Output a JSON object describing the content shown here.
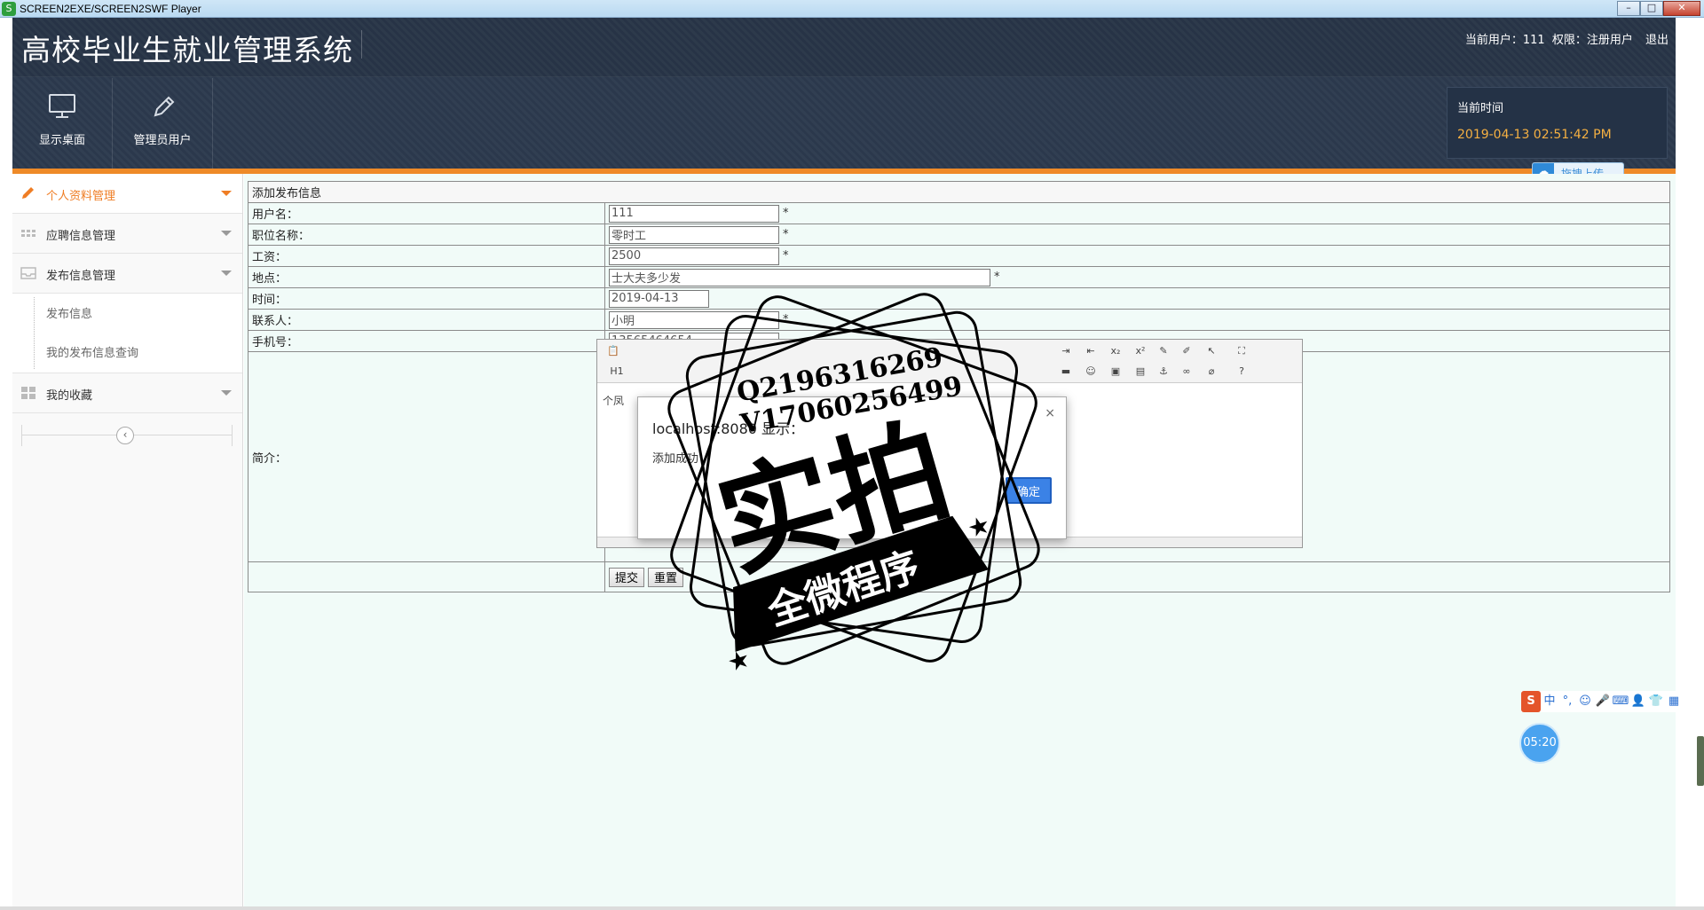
{
  "window": {
    "title": "SCREEN2EXE/SCREEN2SWF Player",
    "min": "–",
    "max": "□",
    "close": "✕"
  },
  "header": {
    "app_title": "高校毕业生就业管理系统",
    "current_user_label": "当前用户：111",
    "role_label": "权限：注册用户",
    "logout": "退出",
    "nav": [
      {
        "label": "显示桌面",
        "icon": "monitor-icon"
      },
      {
        "label": "管理员用户",
        "icon": "pencil-icon"
      }
    ],
    "time_label": "当前时间",
    "time_value": "2019-04-13 02:51:42 PM",
    "upload_label": "拖拽上传"
  },
  "sidebar": {
    "items": [
      {
        "label": "个人资料管理",
        "icon": "pencil-icon",
        "active": true
      },
      {
        "label": "应聘信息管理",
        "icon": "grid-icon"
      },
      {
        "label": "发布信息管理",
        "icon": "inbox-icon"
      },
      {
        "label": "我的收藏",
        "icon": "tiles-icon"
      }
    ],
    "subitems": [
      "发布信息",
      "我的发布信息查询"
    ],
    "collapse": "‹"
  },
  "form": {
    "title": "添加发布信息",
    "fields": [
      {
        "label": "用户名：",
        "value": "111"
      },
      {
        "label": "职位名称：",
        "value": "零时工"
      },
      {
        "label": "工资：",
        "value": "2500"
      },
      {
        "label": "地点：",
        "value": "士大夫多少发"
      },
      {
        "label": "时间：",
        "value": "2019-04-13"
      },
      {
        "label": "联系人：",
        "value": "小明"
      },
      {
        "label": "手机号：",
        "value": "13565464654"
      }
    ],
    "required_mark": "*",
    "intro_label": "简介：",
    "editor_heading": "H1",
    "editor_text": "个凤",
    "submit": "提交",
    "reset": "重置"
  },
  "dialog": {
    "title": "localhost:8080 显示：",
    "message": "添加成功",
    "ok": "确定",
    "close": "×"
  },
  "watermark": {
    "line1": "Q2196316269",
    "line2": "V17060256499",
    "big": "实拍",
    "banner": "全微程序"
  },
  "widgets": {
    "ime": [
      "中",
      "°,",
      "☺",
      "🎤",
      "⌨",
      "👤",
      "👕",
      "▦"
    ],
    "ime_logo": "S",
    "timer": "05:20"
  }
}
